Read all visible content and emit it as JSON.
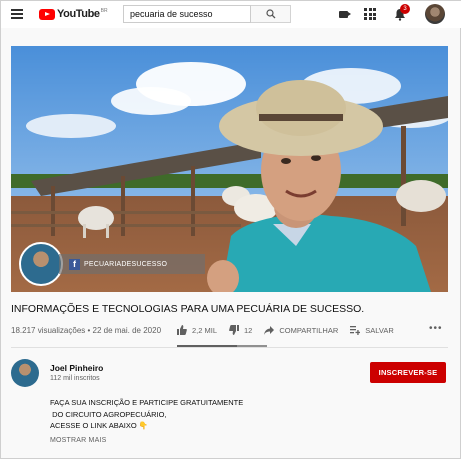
{
  "header": {
    "logo_text": "YouTube",
    "logo_region": "BR",
    "search_value": "pecuaria de sucesso",
    "notification_count": "3",
    "icons": [
      "menu-icon",
      "search-icon",
      "upload-video-icon",
      "apps-icon",
      "notifications-bell-icon",
      "account-avatar"
    ]
  },
  "video": {
    "watermark_channel": "PECUARIADESUCESSO",
    "watermark_network_icon": "f"
  },
  "info": {
    "title": "INFORMAÇÕES E TECNOLOGIAS PARA UMA PECUÁRIA DE SUCESSO.",
    "views_date": "18.217 visualizações • 22 de mai. de 2020",
    "likes": "2,2 MIL",
    "dislikes": "12",
    "share_label": "COMPARTILHAR",
    "save_label": "SALVAR",
    "more_label": "•••"
  },
  "channel": {
    "name": "Joel Pinheiro",
    "subscribers": "112 mil inscritos",
    "subscribe_label": "INSCREVER-SE"
  },
  "description": {
    "line1": "FAÇA SUA INSCRIÇÃO E PARTICIPE GRATUITAMENTE",
    "line2": " DO CIRCUITO AGROPECUÁRIO,",
    "line3": "ACESSE O LINK ABAIXO 👇",
    "show_more": "MOSTRAR MAIS"
  },
  "colors": {
    "brand_red": "#ff0000",
    "subscribe_red": "#cc0000",
    "text_secondary": "#606060"
  }
}
